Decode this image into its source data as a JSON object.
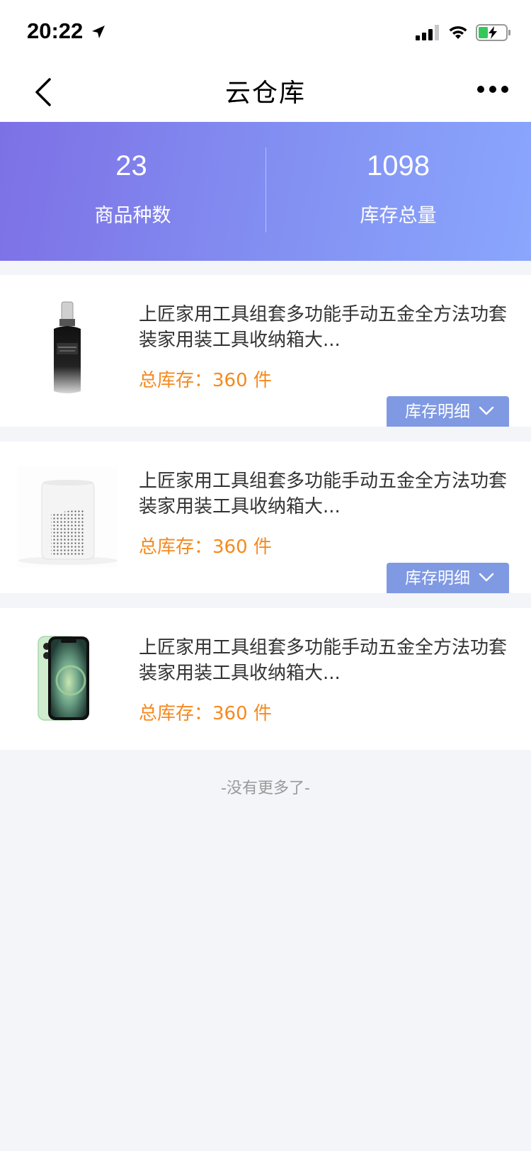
{
  "status_bar": {
    "time": "20:22"
  },
  "nav": {
    "title": "云仓库"
  },
  "stats": {
    "item_types_value": "23",
    "item_types_label": "商品种数",
    "total_stock_value": "1098",
    "total_stock_label": "库存总量"
  },
  "products": [
    {
      "title": "上匠家用工具组套多功能手动五金全方法功套装家用装工具收纳箱大...",
      "stock": "总库存：360 件",
      "detail_label": "库存明细",
      "image": "serum-bottle-image"
    },
    {
      "title": "上匠家用工具组套多功能手动五金全方法功套装家用装工具收纳箱大...",
      "stock": "总库存：360 件",
      "detail_label": "库存明细",
      "image": "smart-speaker-image"
    },
    {
      "title": "上匠家用工具组套多功能手动五金全方法功套装家用装工具收纳箱大...",
      "stock": "总库存：360 件",
      "image": "smartphone-image"
    }
  ],
  "footer": {
    "end_text": "-没有更多了-"
  },
  "colors": {
    "banner_start": "#7d70e6",
    "banner_end": "#8aa6fd",
    "stock_text": "#f58a1f",
    "detail_button": "#7f99e3",
    "page_background": "#f4f5f9"
  }
}
